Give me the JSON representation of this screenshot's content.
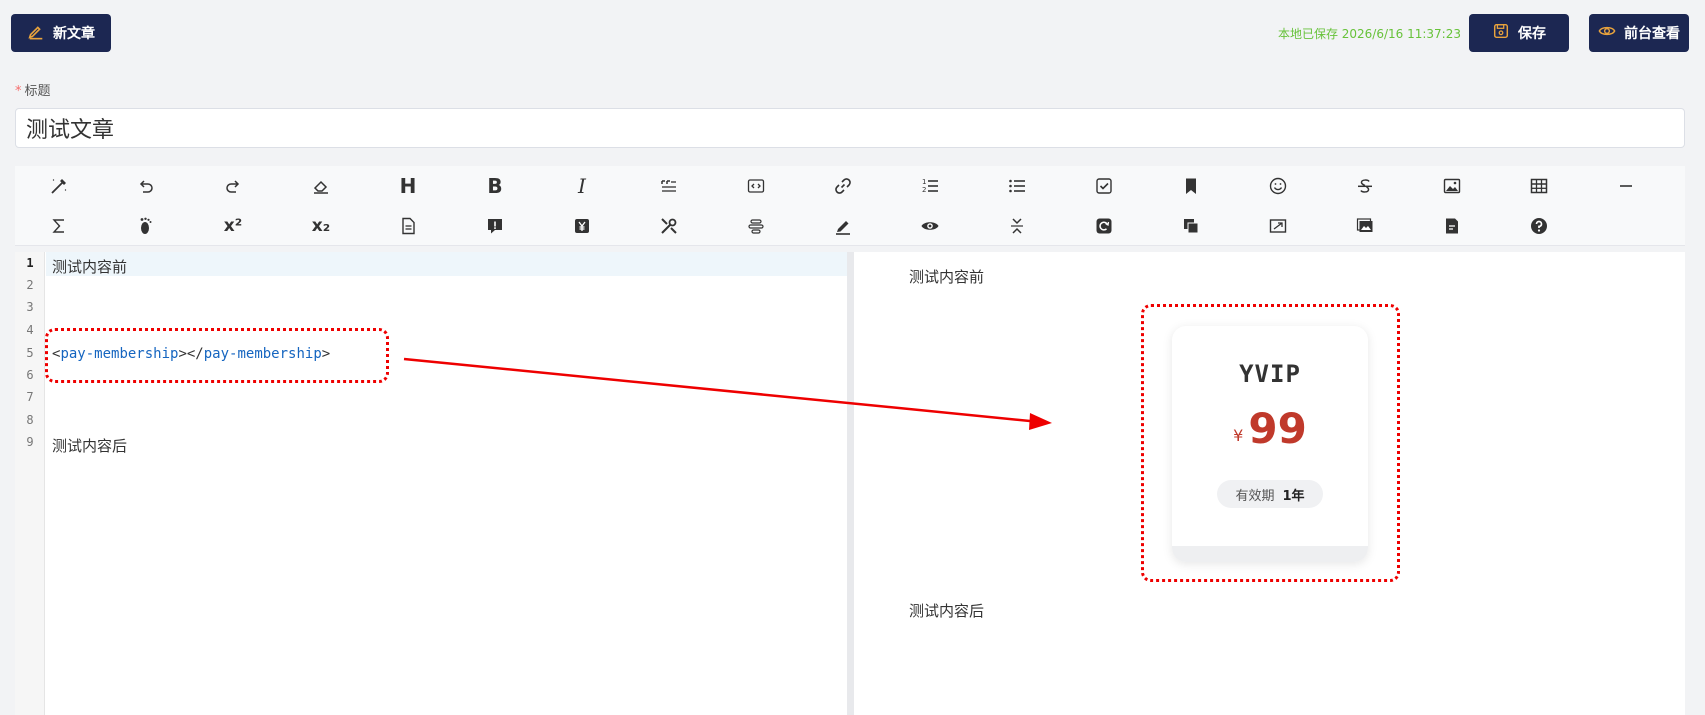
{
  "header": {
    "new_article_label": "新文章",
    "saved_status": "本地已保存 2026/6/16 11:37:23",
    "save_label": "保存",
    "preview_label": "前台查看"
  },
  "form": {
    "title_label": "标题",
    "title_value": "测试文章"
  },
  "toolbar": {
    "row1": [
      "magic-wand-icon",
      "undo-icon",
      "redo-icon",
      "eraser-icon",
      "header-icon",
      "bold-icon",
      "italic-icon",
      "quote-icon",
      "code-block-icon",
      "link-icon",
      "ordered-list-icon",
      "unordered-list-icon",
      "checklist-icon",
      "bookmark-icon",
      "emoji-icon",
      "strikethrough-icon",
      "image-icon",
      "table-icon",
      "horizontal-rule-icon"
    ],
    "row2": [
      "formula-icon",
      "footnote-icon",
      "superscript-icon",
      "subscript-icon",
      "document-icon",
      "comment-icon",
      "yuan-icon",
      "tools-icon",
      "align-icon",
      "highlight-icon",
      "eye-icon",
      "collapse-icon",
      "refresh-icon",
      "copy-icon",
      "fullscreen-icon",
      "gallery-icon",
      "file-icon",
      "help-icon"
    ],
    "header_text": "H",
    "bold_text": "B",
    "italic_text": "I",
    "superscript_text": "x²",
    "subscript_text": "x₂"
  },
  "editor": {
    "line_numbers": [
      "1",
      "2",
      "3",
      "4",
      "5",
      "6",
      "7",
      "8",
      "9"
    ],
    "line1": "测试内容前",
    "line5_tag_open": "pay-membership",
    "line5_tag_close": "pay-membership",
    "line9": "测试内容后"
  },
  "preview": {
    "before_text": "测试内容前",
    "after_text": "测试内容后",
    "card": {
      "name": "YVIP",
      "currency": "¥",
      "price": "99",
      "validity_label": "有效期",
      "validity_value": "1年"
    }
  },
  "colors": {
    "button_bg": "#1c2752",
    "saved_green": "#67c23a",
    "price_red": "#c0392b",
    "highlight_red": "#e00000",
    "tag_blue": "#1565c0"
  }
}
